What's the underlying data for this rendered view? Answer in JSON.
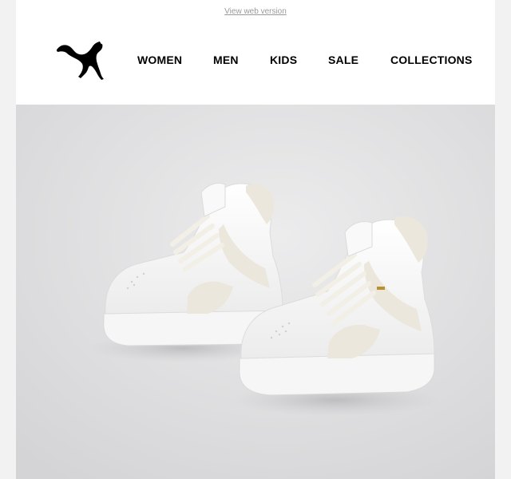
{
  "preheader": {
    "view_web_version": "View web version"
  },
  "brand": {
    "logo_icon": "puma-cat-logo-icon"
  },
  "nav": {
    "items": [
      {
        "label": "WOMEN"
      },
      {
        "label": "MEN"
      },
      {
        "label": "KIDS"
      },
      {
        "label": "SALE"
      },
      {
        "label": "COLLECTIONS"
      }
    ]
  },
  "hero": {
    "image": "white-sneakers-photo",
    "colors": {
      "background": "#dededf",
      "shoe_white": "#f8f8f8",
      "suede_cream": "#ebe7dc"
    }
  }
}
